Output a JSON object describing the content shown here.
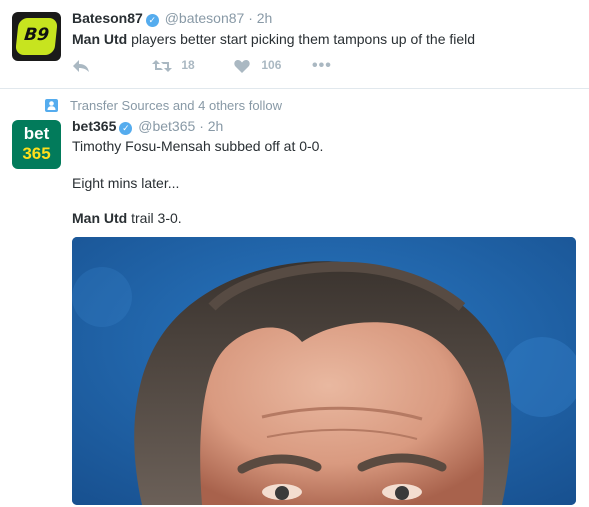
{
  "tweets": [
    {
      "name": "Bateson87",
      "handle": "@bateson87",
      "time": "2h",
      "text_bold": "Man Utd",
      "text_rest": " players better start picking them tampons up of the field",
      "retweets": "18",
      "likes": "106",
      "avatar_label": "B9"
    },
    {
      "social_context": "Transfer Sources and 4 others follow",
      "name": "bet365",
      "handle": "@bet365",
      "time": "2h",
      "avatar_top": "bet",
      "avatar_bottom": "365",
      "line1": "Timothy Fosu-Mensah subbed off at 0-0.",
      "line2": "Eight mins later...",
      "line3_bold": "Man Utd",
      "line3_rest": " trail 3-0.",
      "media": "photo"
    }
  ],
  "colors": {
    "link_blue": "#55acee",
    "muted": "#8899a6",
    "bet365_green": "#027b5b",
    "bet365_yellow": "#ffdf1b",
    "bateson_green": "#c7e41f"
  }
}
